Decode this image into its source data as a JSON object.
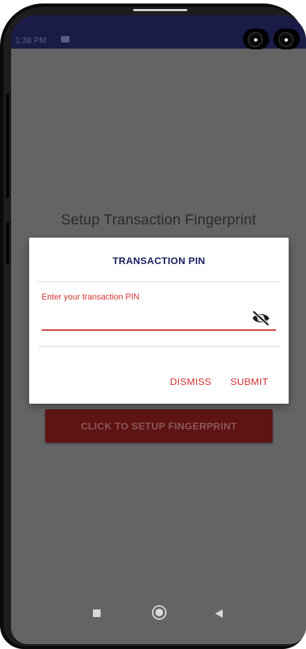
{
  "status_bar": {
    "time": "1:38 PM"
  },
  "screen": {
    "title": "Setup Transaction Fingerprint",
    "setup_button_label": "CLICK TO SETUP FINGERPRINT"
  },
  "dialog": {
    "title": "TRANSACTION PIN",
    "pin_field": {
      "label": "Enter your transaction PIN",
      "value": ""
    },
    "dismiss_label": "DISMISS",
    "submit_label": "SUBMIT"
  },
  "icons": {
    "status_notification": "message-icon",
    "status_alarm": "alarm-icon",
    "visibility_toggle": "eye-off-icon",
    "nav_recents": "square-icon",
    "nav_home": "circle-icon",
    "nav_back": "back-triangle-icon"
  },
  "colors": {
    "accent": "#d32f2f",
    "dialog_title": "#1a1f5e",
    "status_bar": "#1a1b47",
    "scrim": "#646464",
    "setup_button": "#5e1414"
  }
}
